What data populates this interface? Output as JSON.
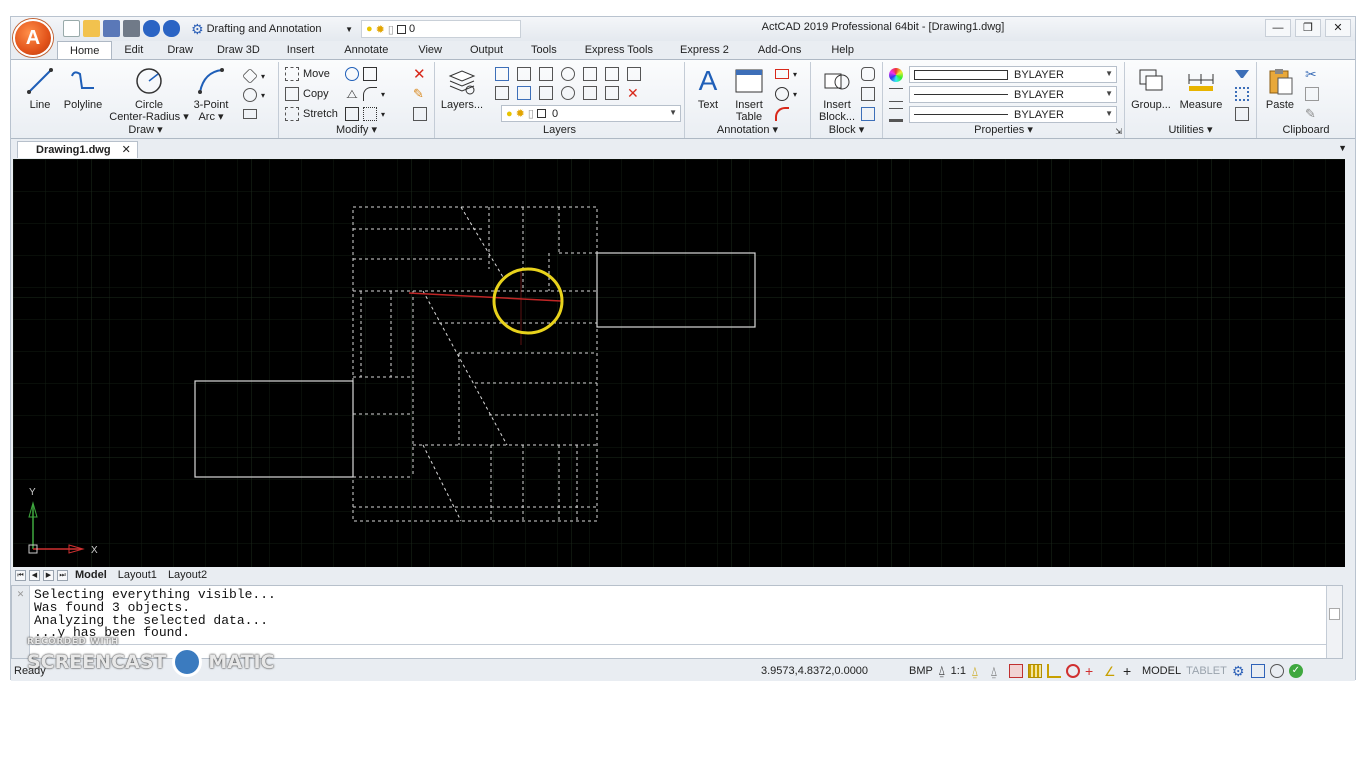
{
  "titlebar": {
    "workspace": "Drafting and Annotation",
    "layer_value": "0",
    "title": "ActCAD 2019 Professional 64bit - [Drawing1.dwg]",
    "minimize": "—",
    "restore": "❐",
    "close": "✕"
  },
  "menu_tabs": [
    "Home",
    "Edit",
    "Draw",
    "Draw 3D",
    "Insert",
    "Annotate",
    "View",
    "Output",
    "Tools",
    "Express Tools",
    "Express 2",
    "Add-Ons",
    "Help"
  ],
  "ribbon": {
    "draw": {
      "label": "Draw ▾",
      "line": "Line",
      "polyline": "Polyline",
      "circle_1": "Circle",
      "circle_2": "Center-Radius ▾",
      "arc_1": "3-Point",
      "arc_2": "Arc ▾"
    },
    "modify": {
      "label": "Modify ▾",
      "move": "Move",
      "copy": "Copy",
      "stretch": "Stretch"
    },
    "layers": {
      "label": "Layers",
      "layers_btn": "Layers...",
      "current_layer": "0"
    },
    "annotation": {
      "label": "Annotation ▾",
      "text": "Text",
      "table_1": "Insert",
      "table_2": "Table"
    },
    "block": {
      "label": "Block ▾",
      "insert_1": "Insert",
      "insert_2": "Block..."
    },
    "properties": {
      "label": "Properties ▾",
      "color": "BYLAYER",
      "linetype": "BYLAYER",
      "lineweight": "BYLAYER"
    },
    "utilities": {
      "label": "Utilities ▾",
      "group": "Group...",
      "measure": "Measure"
    },
    "clipboard": {
      "label": "Clipboard",
      "paste": "Paste"
    }
  },
  "document_tab": {
    "name": "Drawing1.dwg",
    "close": "✕"
  },
  "ucs": {
    "x": "X",
    "y": "Y"
  },
  "layout_tabs": [
    "Model",
    "Layout1",
    "Layout2"
  ],
  "command_history": [
    "Selecting everything visible...",
    "Was found 3 objects.",
    "Analyzing the selected data...",
    "      ...y has been found."
  ],
  "watermark": {
    "line1": "RECORDED WITH",
    "line2a": "SCREENCAST",
    "line2b": "MATIC"
  },
  "statusbar": {
    "ready": "Ready",
    "coords": "3.9573,4.8372,0.0000",
    "bmp": "BMP",
    "scale": "1:1",
    "model": "MODEL",
    "tablet": "TABLET"
  },
  "colors": {
    "canvas_bg": "#000000",
    "grid": "#1a2a1a",
    "dashed_lines": "#d8d8d8",
    "highlight_circle": "#e8d21c",
    "ucs_y": "#3fa83f",
    "ucs_x": "#d03030"
  }
}
